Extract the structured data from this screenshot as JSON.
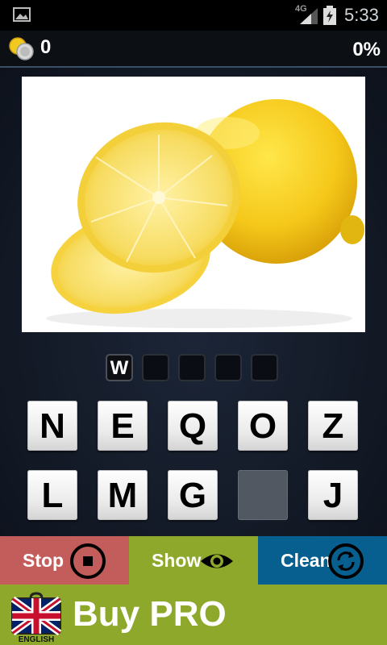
{
  "status_bar": {
    "network": "4G",
    "time": "5:33"
  },
  "header": {
    "coins": "0",
    "progress": "0%"
  },
  "puzzle": {
    "image": "lemon",
    "answer_slots": [
      "W",
      "",
      "",
      "",
      ""
    ]
  },
  "keyboard": {
    "row1": [
      "N",
      "E",
      "Q",
      "O",
      "Z"
    ],
    "row2": [
      "L",
      "M",
      "G",
      "",
      "J"
    ]
  },
  "actions": {
    "stop": "Stop",
    "show": "Show",
    "clean": "Clean"
  },
  "buy": {
    "label": "Buy PRO",
    "language": "ENGLISH"
  },
  "colors": {
    "stop": "#c35d5b",
    "show": "#8ea82b",
    "clean": "#065f8e",
    "buy": "#8ea82b"
  }
}
